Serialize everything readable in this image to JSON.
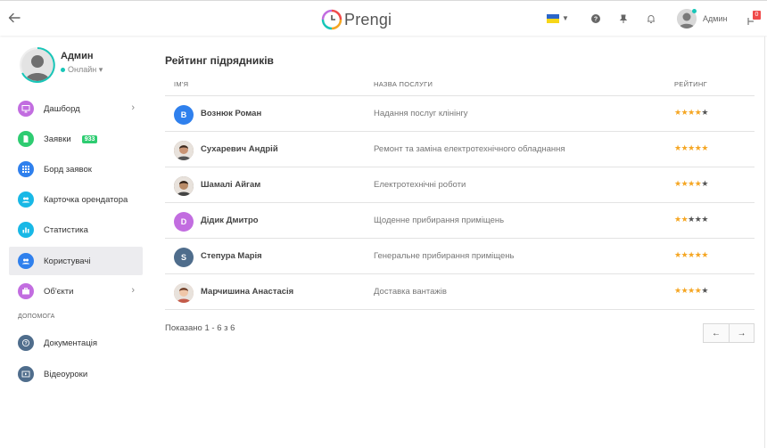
{
  "header": {
    "logo_text": "Prengi",
    "user_name": "Админ",
    "notification_count": "0",
    "language": "UA"
  },
  "profile": {
    "name": "Админ",
    "status": "Онлайн"
  },
  "sidebar": {
    "items": [
      {
        "label": "Дашборд",
        "icon": "monitor-icon",
        "color": "#c26de0",
        "chevron": true
      },
      {
        "label": "Заявки",
        "icon": "document-icon",
        "color": "#2ecc71",
        "badge": "933"
      },
      {
        "label": "Борд заявок",
        "icon": "grid-icon",
        "color": "#2f80ed"
      },
      {
        "label": "Карточка орендатора",
        "icon": "tenant-card-icon",
        "color": "#18b8e6"
      },
      {
        "label": "Статистика",
        "icon": "bar-chart-icon",
        "color": "#18b8e6"
      },
      {
        "label": "Користувачі",
        "icon": "users-icon",
        "color": "#2f80ed",
        "active": true
      },
      {
        "label": "Об'єкти",
        "icon": "briefcase-icon",
        "color": "#c26de0",
        "chevron": true
      }
    ],
    "help_section": "ДОПОМОГА",
    "help_items": [
      {
        "label": "Документація",
        "icon": "help-circle-icon",
        "color": "#4f6d8c"
      },
      {
        "label": "Відеоуроки",
        "icon": "video-icon",
        "color": "#4f6d8c"
      }
    ]
  },
  "main": {
    "title": "Рейтинг підрядників",
    "columns": {
      "name": "ІМ'Я",
      "service": "НАЗВА ПОСЛУГИ",
      "rating": "РЕЙТИНГ"
    },
    "rows": [
      {
        "initial": "В",
        "avatar_color": "#2f80ed",
        "name": "Вознюк Роман",
        "service": "Надання послуг клінінгу",
        "rating": 4
      },
      {
        "initial": "",
        "avatar_color": "#8a6a55",
        "photo": true,
        "name": "Сухаревич Андрій",
        "service": "Ремонт та заміна електротехнічного обладнання",
        "rating": 5
      },
      {
        "initial": "",
        "avatar_color": "#6b5a4a",
        "photo": true,
        "name": "Шамалі Айгам",
        "service": "Електротехнічні роботи",
        "rating": 4
      },
      {
        "initial": "D",
        "avatar_color": "#c26de0",
        "name": "Дідик Дмитро",
        "service": "Щоденне прибирання приміщень",
        "rating": 2
      },
      {
        "initial": "S",
        "avatar_color": "#4f6d8c",
        "name": "Степура Марія",
        "service": "Генеральне прибирання приміщень",
        "rating": 5
      },
      {
        "initial": "",
        "avatar_color": "#d9a08a",
        "photo": true,
        "name": "Марчишина Анастасія",
        "service": "Доставка вантажів",
        "rating": 4
      }
    ],
    "shown_text": "Показано 1 - 6 з 6",
    "pager_prev": "←",
    "pager_next": "→"
  }
}
